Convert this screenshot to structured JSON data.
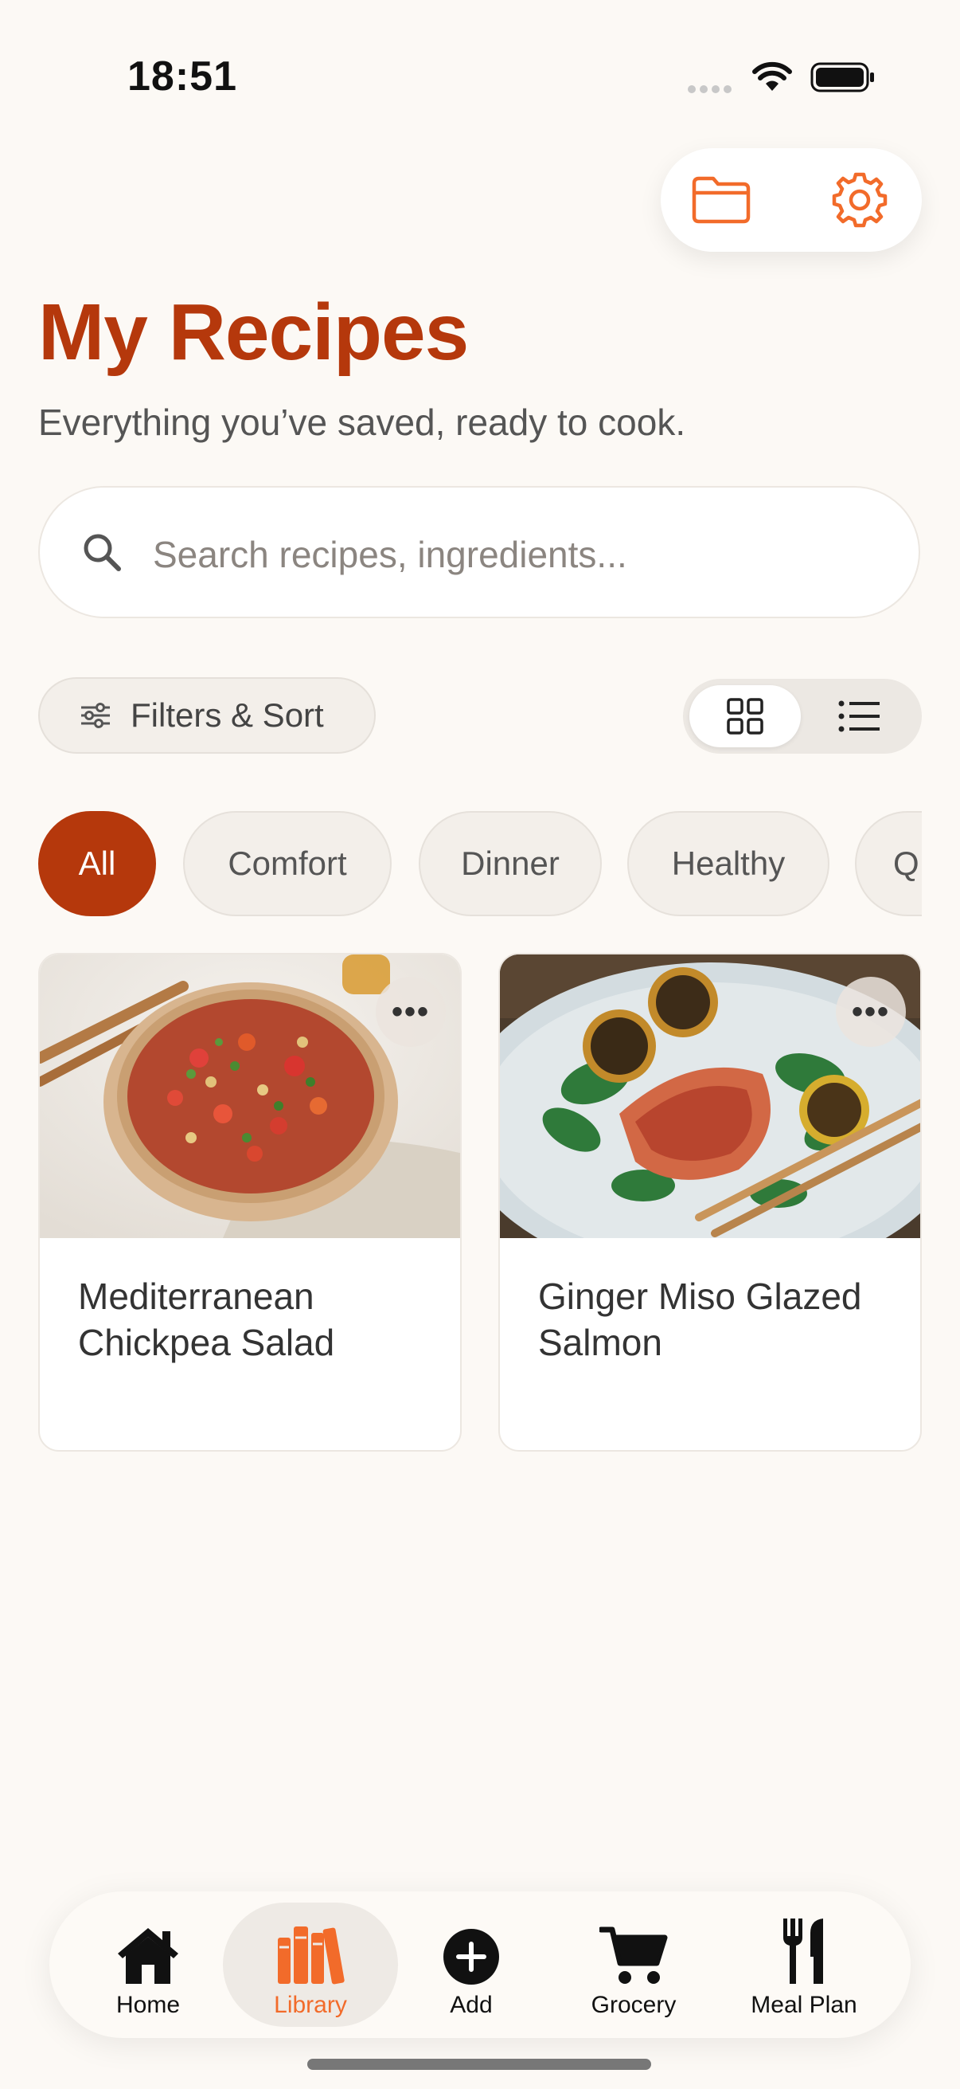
{
  "status_bar": {
    "time": "18:51"
  },
  "header": {
    "title": "My Recipes",
    "subtitle": "Everything you’ve saved, ready to cook.",
    "accent_color": "#b5380c",
    "icon_color": "#f26b2a"
  },
  "search": {
    "placeholder": "Search recipes, ingredients..."
  },
  "filters": {
    "label": "Filters & Sort",
    "view_mode": "grid"
  },
  "categories": [
    "All",
    "Comfort",
    "Dinner",
    "Healthy",
    "Q"
  ],
  "selected_category": "All",
  "recipes": [
    {
      "name": "Mediterranean Chickpea Salad"
    },
    {
      "name": "Ginger Miso Glazed Salmon"
    }
  ],
  "more_label": "•••",
  "tab_bar": {
    "active": "Library",
    "items": [
      {
        "label": "Home",
        "icon": "house-icon"
      },
      {
        "label": "Library",
        "icon": "books-icon"
      },
      {
        "label": "Add",
        "icon": "plus-circle-icon"
      },
      {
        "label": "Grocery",
        "icon": "cart-icon"
      },
      {
        "label": "Meal Plan",
        "icon": "fork-knife-icon"
      }
    ]
  }
}
